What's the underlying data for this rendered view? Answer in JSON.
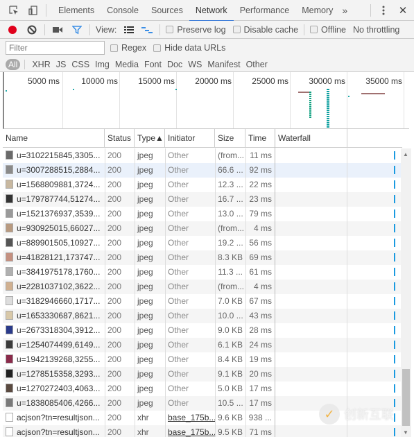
{
  "tabbar": {
    "tabs": [
      "Elements",
      "Console",
      "Sources",
      "Network",
      "Performance",
      "Memory"
    ],
    "active_tab": "Network",
    "more_label": "»",
    "menu_icon": "kebab-menu-icon",
    "close_label": "✕"
  },
  "toolbar": {
    "view_label": "View:",
    "preserve_log_label": "Preserve log",
    "disable_cache_label": "Disable cache",
    "offline_label": "Offline",
    "throttling_label": "No throttling",
    "colors": {
      "record": "#e0001b",
      "filter": "#3a8ee6"
    }
  },
  "filterbar": {
    "filter_placeholder": "Filter",
    "regex_label": "Regex",
    "hide_data_urls_label": "Hide data URLs"
  },
  "typebar": {
    "all_label": "All",
    "types": [
      "XHR",
      "JS",
      "CSS",
      "Img",
      "Media",
      "Font",
      "Doc",
      "WS",
      "Manifest",
      "Other"
    ]
  },
  "overview": {
    "ticks": [
      "5000 ms",
      "10000 ms",
      "15000 ms",
      "20000 ms",
      "25000 ms",
      "30000 ms",
      "35000 ms"
    ]
  },
  "table": {
    "columns": [
      "Name",
      "Status",
      "Type▲",
      "Initiator",
      "Size",
      "Time",
      "Waterfall"
    ],
    "rows": [
      {
        "name": "u=3102215845,3305...",
        "status": "200",
        "type": "jpeg",
        "initiator": "Other",
        "size": "(from...",
        "time": "11 ms",
        "thumb": "#6a6a6a"
      },
      {
        "name": "u=3007288515,2884...",
        "status": "200",
        "type": "jpeg",
        "initiator": "Other",
        "size": "66.6 ...",
        "time": "92 ms",
        "thumb": "#8a8a8a",
        "selected": true
      },
      {
        "name": "u=1568809881,3724...",
        "status": "200",
        "type": "jpeg",
        "initiator": "Other",
        "size": "12.3 ...",
        "time": "22 ms",
        "thumb": "#c8b8a0"
      },
      {
        "name": "u=179787744,51274...",
        "status": "200",
        "type": "jpeg",
        "initiator": "Other",
        "size": "16.7 ...",
        "time": "23 ms",
        "thumb": "#333333"
      },
      {
        "name": "u=1521376937,3539...",
        "status": "200",
        "type": "jpeg",
        "initiator": "Other",
        "size": "13.0 ...",
        "time": "79 ms",
        "thumb": "#9a9a9a"
      },
      {
        "name": "u=930925015,66027...",
        "status": "200",
        "type": "jpeg",
        "initiator": "Other",
        "size": "(from...",
        "time": "4 ms",
        "thumb": "#b89a80"
      },
      {
        "name": "u=889901505,10927...",
        "status": "200",
        "type": "jpeg",
        "initiator": "Other",
        "size": "19.2 ...",
        "time": "56 ms",
        "thumb": "#555555"
      },
      {
        "name": "u=41828121,173747...",
        "status": "200",
        "type": "jpeg",
        "initiator": "Other",
        "size": "8.3 KB",
        "time": "69 ms",
        "thumb": "#c49080"
      },
      {
        "name": "u=3841975178,1760...",
        "status": "200",
        "type": "jpeg",
        "initiator": "Other",
        "size": "11.3 ...",
        "time": "61 ms",
        "thumb": "#b0b0b0"
      },
      {
        "name": "u=2281037102,3622...",
        "status": "200",
        "type": "jpeg",
        "initiator": "Other",
        "size": "(from...",
        "time": "4 ms",
        "thumb": "#d0b090"
      },
      {
        "name": "u=3182946660,1717...",
        "status": "200",
        "type": "jpeg",
        "initiator": "Other",
        "size": "7.0 KB",
        "time": "67 ms",
        "thumb": "#dddddd"
      },
      {
        "name": "u=1653330687,8621...",
        "status": "200",
        "type": "jpeg",
        "initiator": "Other",
        "size": "10.0 ...",
        "time": "43 ms",
        "thumb": "#d8c8a8"
      },
      {
        "name": "u=2673318304,3912...",
        "status": "200",
        "type": "jpeg",
        "initiator": "Other",
        "size": "9.0 KB",
        "time": "28 ms",
        "thumb": "#2a3a8a"
      },
      {
        "name": "u=1254074499,6149...",
        "status": "200",
        "type": "jpeg",
        "initiator": "Other",
        "size": "6.1 KB",
        "time": "24 ms",
        "thumb": "#3a3a3a"
      },
      {
        "name": "u=1942139268,3255...",
        "status": "200",
        "type": "jpeg",
        "initiator": "Other",
        "size": "8.4 KB",
        "time": "19 ms",
        "thumb": "#8a2a4a"
      },
      {
        "name": "u=1278515358,3293...",
        "status": "200",
        "type": "jpeg",
        "initiator": "Other",
        "size": "9.1 KB",
        "time": "20 ms",
        "thumb": "#222222"
      },
      {
        "name": "u=1270272403,4063...",
        "status": "200",
        "type": "jpeg",
        "initiator": "Other",
        "size": "5.0 KB",
        "time": "17 ms",
        "thumb": "#5a4a40"
      },
      {
        "name": "u=1838085406,4266...",
        "status": "200",
        "type": "jpeg",
        "initiator": "Other",
        "size": "10.5 ...",
        "time": "17 ms",
        "thumb": "#7a7a7a"
      },
      {
        "name": "acjson?tn=resultjson...",
        "status": "200",
        "type": "xhr",
        "initiator": "base_175b...",
        "size": "9.6 KB",
        "time": "938 ...",
        "thumb": "#ffffff",
        "initiator_link": true
      },
      {
        "name": "acjson?tn=resultjson...",
        "status": "200",
        "type": "xhr",
        "initiator": "base_175b...",
        "size": "9.5 KB",
        "time": "71 ms",
        "thumb": "#ffffff",
        "initiator_link": true
      }
    ]
  },
  "watermark": {
    "text": "创新互联"
  }
}
